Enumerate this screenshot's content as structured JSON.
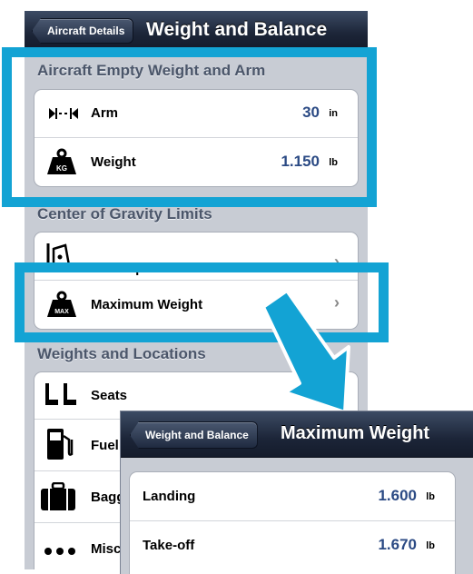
{
  "main": {
    "back_label": "Aircraft Details",
    "title": "Weight and Balance",
    "sections": {
      "empty": {
        "header": "Aircraft Empty Weight and Arm",
        "arm": {
          "label": "Arm",
          "value": "30",
          "unit": "in",
          "icon": "arm-measure-icon"
        },
        "weight": {
          "label": "Weight",
          "value": "1.150",
          "unit": "lb",
          "icon": "kg-weight-icon"
        }
      },
      "cg": {
        "header": "Center of Gravity Limits",
        "envelope": {
          "label": "Envelope",
          "icon": "envelope-graph-icon"
        },
        "max_weight": {
          "label": "Maximum Weight",
          "icon": "max-weight-icon"
        }
      },
      "locations": {
        "header": "Weights and Locations",
        "seats": {
          "label": "Seats",
          "icon": "seats-icon"
        },
        "fuel": {
          "label": "Fuel",
          "icon": "fuel-pump-icon"
        },
        "baggage": {
          "label": "Bagg",
          "icon": "suitcase-icon"
        },
        "misc": {
          "label": "Misc",
          "icon": "ellipsis-icon"
        }
      }
    }
  },
  "inset": {
    "back_label": "Weight and Balance",
    "title": "Maximum Weight",
    "rows": [
      {
        "label": "Landing",
        "value": "1.600",
        "unit": "lb"
      },
      {
        "label": "Take-off",
        "value": "1.670",
        "unit": "lb"
      }
    ]
  },
  "colors": {
    "highlight": "#13a3d4",
    "value_text": "#2b4a84",
    "nav_bar": "#1c2538"
  }
}
